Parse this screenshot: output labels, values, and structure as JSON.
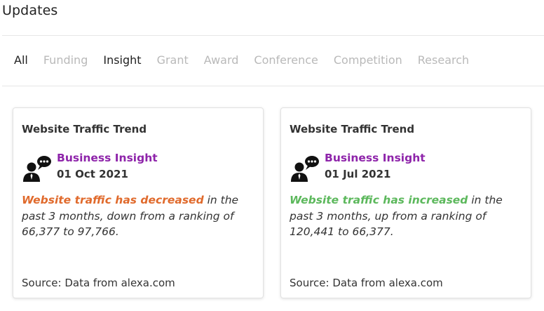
{
  "page": {
    "title": "Updates"
  },
  "tabs": [
    {
      "label": "All",
      "active": true
    },
    {
      "label": "Funding",
      "active": false
    },
    {
      "label": "Insight",
      "active": true
    },
    {
      "label": "Grant",
      "active": false
    },
    {
      "label": "Award",
      "active": false
    },
    {
      "label": "Conference",
      "active": false
    },
    {
      "label": "Competition",
      "active": false
    },
    {
      "label": "Research",
      "active": false
    }
  ],
  "cards": [
    {
      "title": "Website Traffic Trend",
      "icon": "business-insight-icon",
      "type": "Business Insight",
      "date": "01 Oct 2021",
      "highlight": "Website traffic has decreased",
      "highlight_color": "#e06a2c",
      "body": " in the past 3 months, down from a ranking of 66,377 to 97,766.",
      "source": "Source: Data from alexa.com"
    },
    {
      "title": "Website Traffic Trend",
      "icon": "business-insight-icon",
      "type": "Business Insight",
      "date": "01 Jul 2021",
      "highlight": "Website traffic has increased",
      "highlight_color": "#5cb85c",
      "body": " in the past 3 months, up from a ranking of 120,441 to 66,377.",
      "source": "Source: Data from alexa.com"
    }
  ],
  "colors": {
    "accent_purple": "#8e24aa",
    "inactive_tab": "#b9b9b9"
  }
}
